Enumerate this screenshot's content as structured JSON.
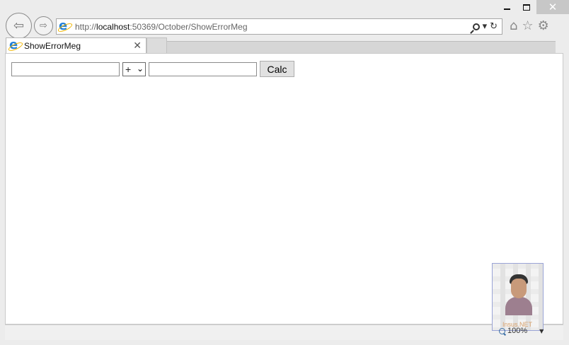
{
  "window": {
    "close_glyph": "✕"
  },
  "nav": {
    "back_glyph": "⇦",
    "forward_glyph": "⇨"
  },
  "address": {
    "url_prefix": "http://",
    "url_host": "localhost",
    "url_rest": ":50369/October/ShowErrorMeg",
    "dropdown_glyph": "▾",
    "refresh_glyph": "↻"
  },
  "toolbar": {
    "home_glyph": "⌂",
    "favorites_glyph": "☆",
    "tools_glyph": "⚙"
  },
  "tab": {
    "title": "ShowErrorMeg",
    "close_glyph": "✕"
  },
  "form": {
    "first_value": "",
    "operator": "+",
    "operator_chevron": "⌄",
    "second_value": "",
    "calc_label": "Calc"
  },
  "overlay": {
    "brand": "Insus.NET"
  },
  "status": {
    "zoom": "100%",
    "zoom_dropdown": "▼"
  }
}
